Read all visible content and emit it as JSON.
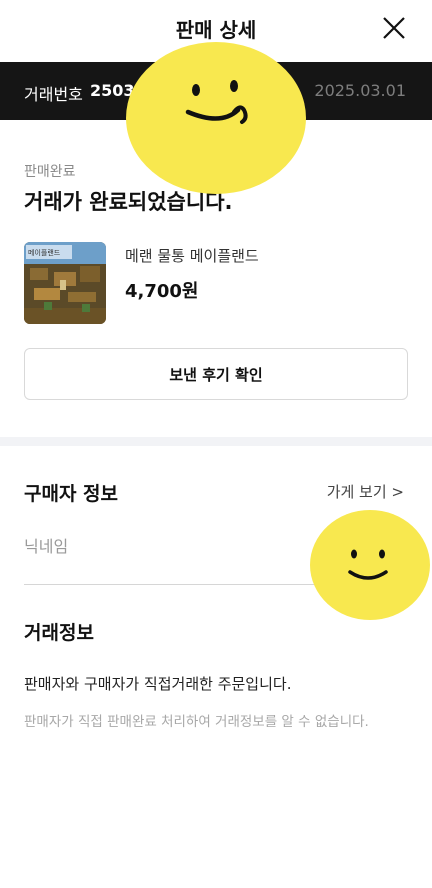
{
  "header": {
    "title": "판매 상세"
  },
  "transaction_bar": {
    "label": "거래번호",
    "number": "2503",
    "date": "2025.03.01"
  },
  "status": {
    "label": "판매완료",
    "title": "거래가 완료되었습니다."
  },
  "product": {
    "name": "메랜 물통 메이플랜드",
    "price": "4,700원",
    "thumb_caption": "메이플랜드"
  },
  "review_button": {
    "label": "보낸 후기 확인"
  },
  "buyer": {
    "title": "구매자 정보",
    "store_link": "가게 보기 >",
    "nickname_label": "닉네임"
  },
  "transaction_info": {
    "title": "거래정보",
    "description": "판매자와 구매자가 직접거래한 주문입니다.",
    "note": "판매자가 직접 판매완료 처리하여 거래정보를 알 수 없습니다."
  },
  "colors": {
    "dark_bar": "#151515",
    "sticker_yellow": "#f8e84f",
    "divider_gray": "#f2f3f6"
  }
}
